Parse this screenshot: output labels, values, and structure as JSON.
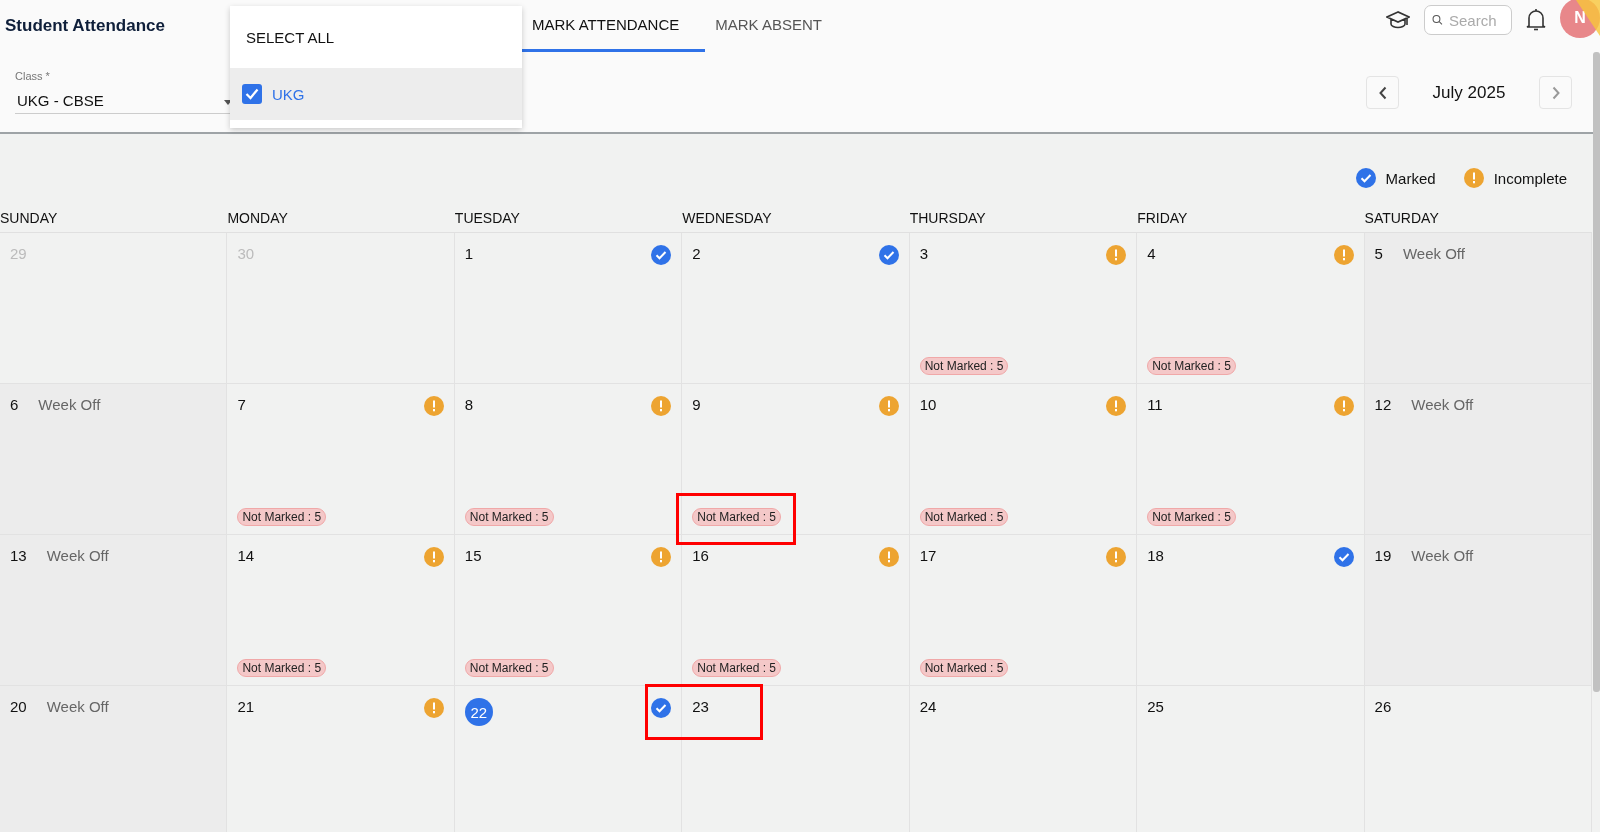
{
  "title": "Student Attendance",
  "class_field": {
    "label": "Class *",
    "value": "UKG - CBSE"
  },
  "dropdown": {
    "select_all": "SELECT ALL",
    "options": [
      {
        "label": "UKG",
        "checked": true
      }
    ]
  },
  "tabs": [
    {
      "label": "MARK ATTENDANCE",
      "selected": true
    },
    {
      "label": "MARK ABSENT",
      "selected": false
    }
  ],
  "search": {
    "placeholder": "Search"
  },
  "avatar": "N",
  "month": "July 2025",
  "legend": [
    {
      "kind": "marked",
      "label": "Marked"
    },
    {
      "kind": "incomplete",
      "label": "Incomplete"
    }
  ],
  "weekdays": [
    "SUNDAY",
    "MONDAY",
    "TUESDAY",
    "WEDNESDAY",
    "THURSDAY",
    "FRIDAY",
    "SATURDAY"
  ],
  "weeks": [
    [
      {
        "day": "29",
        "muted": true
      },
      {
        "day": "30",
        "muted": true
      },
      {
        "day": "1",
        "kind": "marked"
      },
      {
        "day": "2",
        "kind": "marked"
      },
      {
        "day": "3",
        "kind": "incomplete",
        "badge": "Not Marked : 5"
      },
      {
        "day": "4",
        "kind": "incomplete",
        "badge": "Not Marked : 5"
      },
      {
        "day": "5",
        "off": "Week Off"
      }
    ],
    [
      {
        "day": "6",
        "off": "Week Off"
      },
      {
        "day": "7",
        "kind": "incomplete",
        "badge": "Not Marked : 5"
      },
      {
        "day": "8",
        "kind": "incomplete",
        "badge": "Not Marked : 5"
      },
      {
        "day": "9",
        "kind": "incomplete",
        "badge": "Not Marked : 5",
        "highlighted": true
      },
      {
        "day": "10",
        "kind": "incomplete",
        "badge": "Not Marked : 5"
      },
      {
        "day": "11",
        "kind": "incomplete",
        "badge": "Not Marked : 5"
      },
      {
        "day": "12",
        "off": "Week Off"
      }
    ],
    [
      {
        "day": "13",
        "off": "Week Off"
      },
      {
        "day": "14",
        "kind": "incomplete",
        "badge": "Not Marked : 5"
      },
      {
        "day": "15",
        "kind": "incomplete",
        "badge": "Not Marked : 5"
      },
      {
        "day": "16",
        "kind": "incomplete",
        "badge": "Not Marked : 5"
      },
      {
        "day": "17",
        "kind": "incomplete",
        "badge": "Not Marked : 5"
      },
      {
        "day": "18",
        "kind": "marked"
      },
      {
        "day": "19",
        "off": "Week Off"
      }
    ],
    [
      {
        "day": "20",
        "off": "Week Off"
      },
      {
        "day": "21",
        "kind": "incomplete"
      },
      {
        "day": "22",
        "kind": "marked",
        "today": true
      },
      {
        "day": "23",
        "highlighted": true
      },
      {
        "day": "24"
      },
      {
        "day": "25"
      },
      {
        "day": "26"
      }
    ]
  ]
}
